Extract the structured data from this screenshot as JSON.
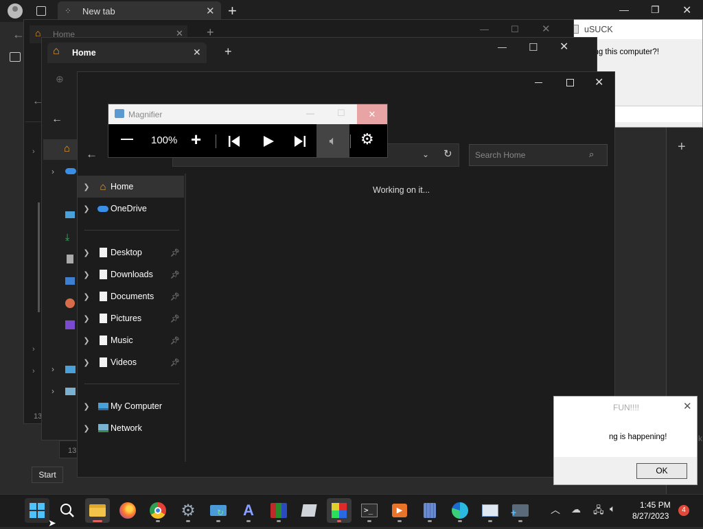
{
  "browser": {
    "tab_title": "New tab",
    "new_tab_plus": "+"
  },
  "back_explorer1": {
    "tab_title": "Home",
    "count": "13"
  },
  "back_explorer2": {
    "tab_title": "Home",
    "count": "13"
  },
  "usuck": {
    "title": "uSUCK",
    "message": "l using this computer?!"
  },
  "magnifier": {
    "title": "Magnifier",
    "zoom": "100%",
    "minus": "—",
    "plus": "+"
  },
  "explorer": {
    "search_placeholder": "Search Home",
    "status": "Working on it...",
    "nav": {
      "top": [
        {
          "label": "Home"
        },
        {
          "label": "OneDrive"
        }
      ],
      "pinned": [
        {
          "label": "Desktop"
        },
        {
          "label": "Downloads"
        },
        {
          "label": "Documents"
        },
        {
          "label": "Pictures"
        },
        {
          "label": "Music"
        },
        {
          "label": "Videos"
        }
      ],
      "bottom": [
        {
          "label": "My Computer"
        },
        {
          "label": "Network"
        }
      ]
    }
  },
  "fun_dialog": {
    "title": "FUN!!!!",
    "message": "ng is happening!",
    "ok": "OK"
  },
  "start_tooltip": "Start",
  "taskbar": {
    "time": "1:45 PM",
    "date": "8/27/2023",
    "notification_count": "4"
  }
}
